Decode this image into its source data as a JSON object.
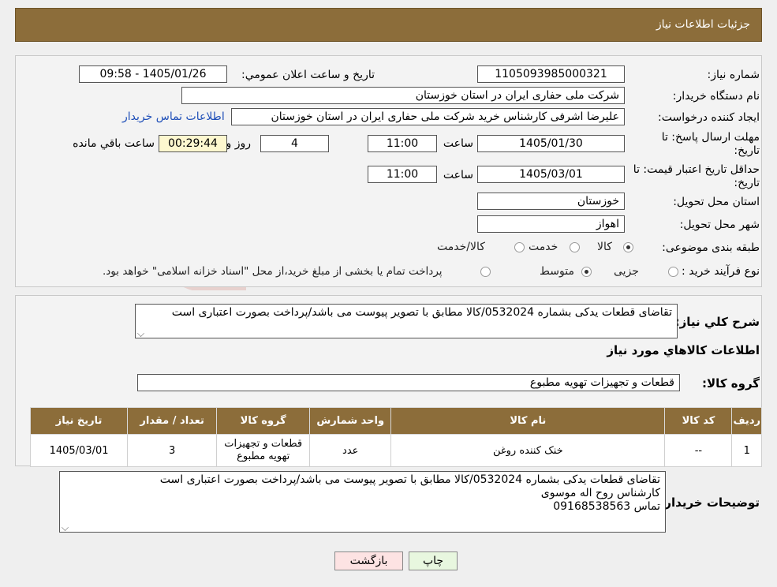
{
  "header": {
    "title": "جزئیات اطلاعات نیاز"
  },
  "form": {
    "need_number_label": "شماره نیاز:",
    "need_number": "1105093985000321",
    "announce_label": "تاریخ و ساعت اعلان عمومي:",
    "announce_value": "1405/01/26 - 09:58",
    "buyer_org_label": "نام دستگاه خریدار:",
    "buyer_org": "شرکت ملی حفاری ایران در استان خوزستان",
    "creator_label": "ایجاد کننده درخواست:",
    "creator": "علیرضا اشرفی کارشناس خرید شرکت ملی حفاری ایران در استان خوزستان",
    "contact_link": "اطلاعات تماس خریدار",
    "reply_label_1": "مهلت ارسال پاسخ: تا",
    "reply_label_2": "تاریخ:",
    "reply_date": "1405/01/30",
    "time_label": "ساعت",
    "reply_time": "11:00",
    "days_value": "4",
    "days_label": "روز و",
    "remaining_value": "00:29:44",
    "remaining_label": "ساعت باقي مانده",
    "price_label_1": "حداقل تاریخ اعتبار قیمت: تا",
    "price_label_2": "تاریخ:",
    "price_date": "1405/03/01",
    "price_time": "11:00",
    "province_label": "استان محل تحویل:",
    "province": "خوزستان",
    "city_label": "شهر محل تحویل:",
    "city": "اهواز",
    "category_label": "طبقه بندی موضوعی:",
    "category_options": [
      "کالا",
      "خدمت",
      "کالا/خدمت"
    ],
    "process_label": "نوع فرآیند خرید :",
    "process_options": [
      "جزیی",
      "متوسط"
    ],
    "process_note": "پرداخت تمام یا بخشی از مبلغ خرید،از محل \"اسناد خزانه اسلامی\" خواهد بود."
  },
  "summary": {
    "label": "شرح کلي نیاز:",
    "text": "تقاضای قطعات یدکی بشماره 0532024/کالا مطابق با تصویر پیوست می باشد/پرداخت بصورت اعتباری است",
    "goods_info_title": "اطلاعات کالاهاي مورد نياز",
    "group_label": "گروه کالا:",
    "group_value": "قطعات و تجهیزات تهویه مطبوع"
  },
  "table": {
    "headers": [
      "رديف",
      "کد کالا",
      "نام کالا",
      "واحد شمارش",
      "گروه کالا",
      "تعداد / مقدار",
      "تاریخ نیاز"
    ],
    "rows": [
      {
        "row": "1",
        "code": "--",
        "name": "خنک کننده روغن",
        "unit": "عدد",
        "group": "قطعات و تجهیزات تهویه مطبوع",
        "qty": "3",
        "date": "1405/03/01"
      }
    ]
  },
  "buyer_notes": {
    "label": "توضیحات خریدار:",
    "lines": [
      "تقاضای قطعات یدکی بشماره 0532024/کالا مطابق با تصویر پیوست می باشد/پرداخت بصورت اعتباری است",
      "کارشناس روح اله موسوی",
      "تماس 09168538563"
    ]
  },
  "buttons": {
    "print": "چاپ",
    "back": "بازگشت"
  },
  "colors": {
    "header_bg": "#8c6d3a",
    "link": "#1f4fb8",
    "back_btn": "#fde3e3",
    "print_btn": "#e8f7df"
  }
}
